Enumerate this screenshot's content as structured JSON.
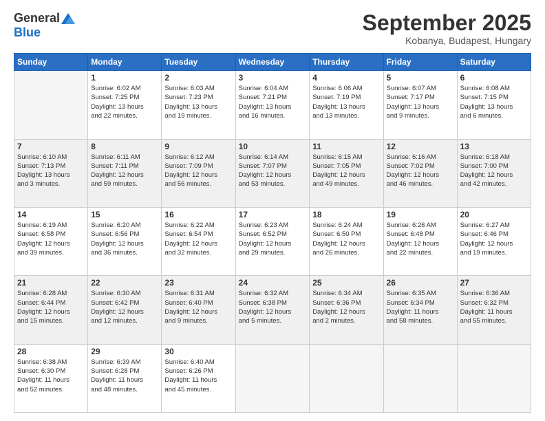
{
  "logo": {
    "general": "General",
    "blue": "Blue"
  },
  "title": "September 2025",
  "subtitle": "Kobanya, Budapest, Hungary",
  "headers": [
    "Sunday",
    "Monday",
    "Tuesday",
    "Wednesday",
    "Thursday",
    "Friday",
    "Saturday"
  ],
  "weeks": [
    [
      {
        "day": "",
        "info": ""
      },
      {
        "day": "1",
        "info": "Sunrise: 6:02 AM\nSunset: 7:25 PM\nDaylight: 13 hours\nand 22 minutes."
      },
      {
        "day": "2",
        "info": "Sunrise: 6:03 AM\nSunset: 7:23 PM\nDaylight: 13 hours\nand 19 minutes."
      },
      {
        "day": "3",
        "info": "Sunrise: 6:04 AM\nSunset: 7:21 PM\nDaylight: 13 hours\nand 16 minutes."
      },
      {
        "day": "4",
        "info": "Sunrise: 6:06 AM\nSunset: 7:19 PM\nDaylight: 13 hours\nand 13 minutes."
      },
      {
        "day": "5",
        "info": "Sunrise: 6:07 AM\nSunset: 7:17 PM\nDaylight: 13 hours\nand 9 minutes."
      },
      {
        "day": "6",
        "info": "Sunrise: 6:08 AM\nSunset: 7:15 PM\nDaylight: 13 hours\nand 6 minutes."
      }
    ],
    [
      {
        "day": "7",
        "info": "Sunrise: 6:10 AM\nSunset: 7:13 PM\nDaylight: 13 hours\nand 3 minutes."
      },
      {
        "day": "8",
        "info": "Sunrise: 6:11 AM\nSunset: 7:11 PM\nDaylight: 12 hours\nand 59 minutes."
      },
      {
        "day": "9",
        "info": "Sunrise: 6:12 AM\nSunset: 7:09 PM\nDaylight: 12 hours\nand 56 minutes."
      },
      {
        "day": "10",
        "info": "Sunrise: 6:14 AM\nSunset: 7:07 PM\nDaylight: 12 hours\nand 53 minutes."
      },
      {
        "day": "11",
        "info": "Sunrise: 6:15 AM\nSunset: 7:05 PM\nDaylight: 12 hours\nand 49 minutes."
      },
      {
        "day": "12",
        "info": "Sunrise: 6:16 AM\nSunset: 7:02 PM\nDaylight: 12 hours\nand 46 minutes."
      },
      {
        "day": "13",
        "info": "Sunrise: 6:18 AM\nSunset: 7:00 PM\nDaylight: 12 hours\nand 42 minutes."
      }
    ],
    [
      {
        "day": "14",
        "info": "Sunrise: 6:19 AM\nSunset: 6:58 PM\nDaylight: 12 hours\nand 39 minutes."
      },
      {
        "day": "15",
        "info": "Sunrise: 6:20 AM\nSunset: 6:56 PM\nDaylight: 12 hours\nand 36 minutes."
      },
      {
        "day": "16",
        "info": "Sunrise: 6:22 AM\nSunset: 6:54 PM\nDaylight: 12 hours\nand 32 minutes."
      },
      {
        "day": "17",
        "info": "Sunrise: 6:23 AM\nSunset: 6:52 PM\nDaylight: 12 hours\nand 29 minutes."
      },
      {
        "day": "18",
        "info": "Sunrise: 6:24 AM\nSunset: 6:50 PM\nDaylight: 12 hours\nand 26 minutes."
      },
      {
        "day": "19",
        "info": "Sunrise: 6:26 AM\nSunset: 6:48 PM\nDaylight: 12 hours\nand 22 minutes."
      },
      {
        "day": "20",
        "info": "Sunrise: 6:27 AM\nSunset: 6:46 PM\nDaylight: 12 hours\nand 19 minutes."
      }
    ],
    [
      {
        "day": "21",
        "info": "Sunrise: 6:28 AM\nSunset: 6:44 PM\nDaylight: 12 hours\nand 15 minutes."
      },
      {
        "day": "22",
        "info": "Sunrise: 6:30 AM\nSunset: 6:42 PM\nDaylight: 12 hours\nand 12 minutes."
      },
      {
        "day": "23",
        "info": "Sunrise: 6:31 AM\nSunset: 6:40 PM\nDaylight: 12 hours\nand 9 minutes."
      },
      {
        "day": "24",
        "info": "Sunrise: 6:32 AM\nSunset: 6:38 PM\nDaylight: 12 hours\nand 5 minutes."
      },
      {
        "day": "25",
        "info": "Sunrise: 6:34 AM\nSunset: 6:36 PM\nDaylight: 12 hours\nand 2 minutes."
      },
      {
        "day": "26",
        "info": "Sunrise: 6:35 AM\nSunset: 6:34 PM\nDaylight: 11 hours\nand 58 minutes."
      },
      {
        "day": "27",
        "info": "Sunrise: 6:36 AM\nSunset: 6:32 PM\nDaylight: 11 hours\nand 55 minutes."
      }
    ],
    [
      {
        "day": "28",
        "info": "Sunrise: 6:38 AM\nSunset: 6:30 PM\nDaylight: 11 hours\nand 52 minutes."
      },
      {
        "day": "29",
        "info": "Sunrise: 6:39 AM\nSunset: 6:28 PM\nDaylight: 11 hours\nand 48 minutes."
      },
      {
        "day": "30",
        "info": "Sunrise: 6:40 AM\nSunset: 6:26 PM\nDaylight: 11 hours\nand 45 minutes."
      },
      {
        "day": "",
        "info": ""
      },
      {
        "day": "",
        "info": ""
      },
      {
        "day": "",
        "info": ""
      },
      {
        "day": "",
        "info": ""
      }
    ]
  ]
}
